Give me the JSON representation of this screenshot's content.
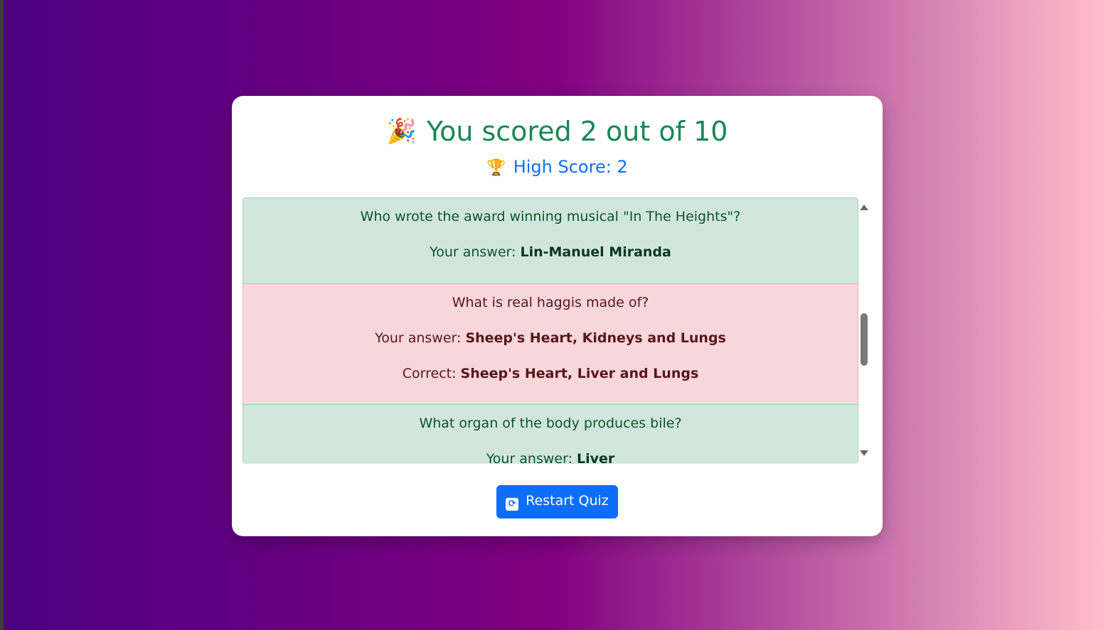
{
  "result": {
    "title": "You scored 2 out of 10",
    "title_icon": "party-popper-icon",
    "high_score": "High Score: 2",
    "high_score_icon": "trophy-icon"
  },
  "review": [
    {
      "status": "correct",
      "question": "Who wrote the award winning musical \"In The Heights\"?",
      "your_answer_label": "Your answer:",
      "your_answer": "Lin-Manuel Miranda"
    },
    {
      "status": "wrong",
      "question": "What is real haggis made of?",
      "your_answer_label": "Your answer:",
      "your_answer": "Sheep's Heart, Kidneys and Lungs",
      "correct_label": "Correct:",
      "correct_answer": "Sheep's Heart, Liver and Lungs"
    },
    {
      "status": "correct",
      "question": "What organ of the body produces bile?",
      "your_answer_label": "Your answer:",
      "your_answer": "Liver"
    }
  ],
  "actions": {
    "restart_label": "Restart Quiz",
    "restart_icon": "refresh-icon"
  },
  "colors": {
    "success": "#198754",
    "primary": "#0d6efd",
    "correct_bg": "#d1e7dd",
    "wrong_bg": "#f8d7da"
  }
}
